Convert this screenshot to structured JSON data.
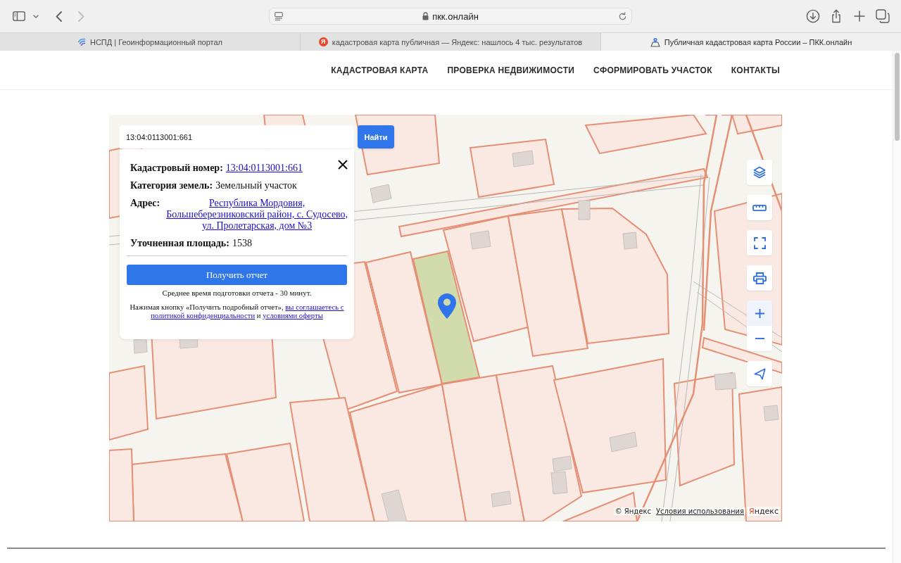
{
  "browser": {
    "back_disabled": false,
    "forward_disabled": true,
    "address": "пкк.онлайн",
    "tabs": [
      {
        "kind": "portal",
        "title": "НСПД | Геоинформационный портал",
        "selected": false
      },
      {
        "kind": "letter",
        "icon_letter": "Я",
        "title": "кадастровая карта публичная — Яндекс: нашлось 4 тыс. результатов",
        "selected": false
      },
      {
        "kind": "map",
        "title": "Публичная кадастровая карта России – ПКК.онлайн",
        "selected": true
      }
    ]
  },
  "nav": {
    "items": [
      "КАДАСТРОВАЯ КАРТА",
      "ПРОВЕРКА НЕДВИЖИМОСТИ",
      "СФОРМИРОВАТЬ УЧАСТОК",
      "КОНТАКТЫ"
    ]
  },
  "map": {
    "search": {
      "value": "13:04:0113001:661",
      "button": "Найти"
    },
    "info_popup": {
      "fields": [
        {
          "kind": "link",
          "label": "Кадастровый номер:",
          "value": "13:04:0113001:661"
        },
        {
          "kind": "text",
          "label": "Категория земель:",
          "value": "Земельный участок"
        },
        {
          "kind": "address",
          "label": "Адрес:",
          "value": "Республика Мордовия, Большеберезниковский район, с. Судосево, ул. Пролетарская, дом №3"
        },
        {
          "kind": "text",
          "label": "Уточненная площадь:",
          "value": "1538"
        }
      ],
      "button": "Получить отчет",
      "note": "Среднее время подготовки отчета - 30 минут.",
      "consent": [
        {
          "kind": "text",
          "text": "Нажимая кнопку «Получить подробный отчет»,"
        },
        {
          "kind": "link",
          "text": "вы соглашаетесь с"
        },
        {
          "kind": "link",
          "text": "политикой конфиденциальности"
        },
        {
          "kind": "text",
          "text": "и"
        },
        {
          "kind": "link",
          "text": "условиями оферты"
        }
      ]
    },
    "zoom_in_hovered": true,
    "attribution": {
      "copyright": "© Яндекс",
      "terms": "Условия использования",
      "logo": "Яндекс"
    }
  }
}
